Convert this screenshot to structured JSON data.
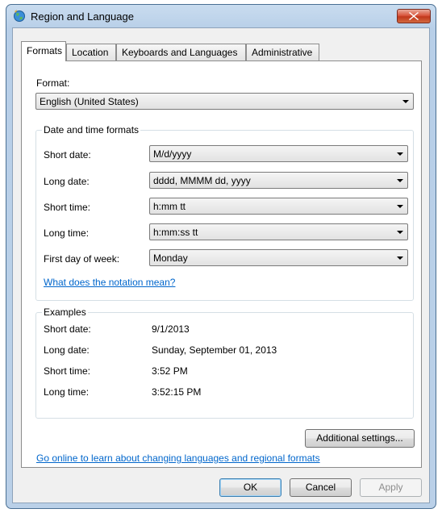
{
  "window": {
    "title": "Region and Language"
  },
  "tabs": [
    {
      "label": "Formats"
    },
    {
      "label": "Location"
    },
    {
      "label": "Keyboards and Languages"
    },
    {
      "label": "Administrative"
    }
  ],
  "format": {
    "label": "Format:",
    "value": "English (United States)"
  },
  "date_time_formats": {
    "title": "Date and time formats",
    "short_date": {
      "label": "Short date:",
      "value": "M/d/yyyy"
    },
    "long_date": {
      "label": "Long date:",
      "value": "dddd, MMMM dd, yyyy"
    },
    "short_time": {
      "label": "Short time:",
      "value": "h:mm tt"
    },
    "long_time": {
      "label": "Long time:",
      "value": "h:mm:ss tt"
    },
    "first_day": {
      "label": "First day of week:",
      "value": "Monday"
    },
    "notation_link": "What does the notation mean?"
  },
  "examples": {
    "title": "Examples",
    "short_date": {
      "label": "Short date:",
      "value": "9/1/2013"
    },
    "long_date": {
      "label": "Long date:",
      "value": "Sunday, September 01, 2013"
    },
    "short_time": {
      "label": "Short time:",
      "value": "3:52 PM"
    },
    "long_time": {
      "label": "Long time:",
      "value": "3:52:15 PM"
    }
  },
  "additional_settings_label": "Additional settings...",
  "online_link": "Go online to learn about changing languages and regional formats",
  "buttons": {
    "ok": "OK",
    "cancel": "Cancel",
    "apply": "Apply"
  },
  "colors": {
    "link": "#0066cc",
    "close": "#c1381c",
    "frame": "#bad0e8"
  }
}
